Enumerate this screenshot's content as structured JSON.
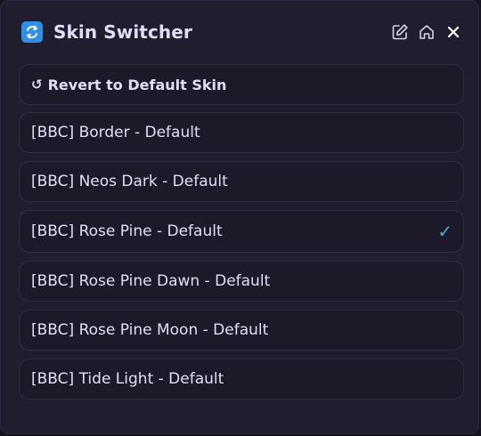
{
  "header": {
    "title": "Skin Switcher",
    "app_icon": "refresh-app-icon",
    "buttons": [
      {
        "icon": "edit-icon"
      },
      {
        "icon": "home-icon"
      },
      {
        "icon": "close-icon"
      }
    ]
  },
  "revert": {
    "glyph": "↺",
    "label": "Revert to Default Skin"
  },
  "skins": [
    {
      "label": "[BBC] Border - Default",
      "selected": false
    },
    {
      "label": "[BBC] Neos Dark - Default",
      "selected": false
    },
    {
      "label": "[BBC] Rose Pine - Default",
      "selected": true
    },
    {
      "label": "[BBC] Rose Pine Dawn - Default",
      "selected": false
    },
    {
      "label": "[BBC] Rose Pine Moon - Default",
      "selected": false
    },
    {
      "label": "[BBC] Tide Light - Default",
      "selected": false
    }
  ],
  "check_glyph": "✓",
  "colors": {
    "panel_bg": "#1f1d2e",
    "text": "#e0def4",
    "accent_check": "#4fa6d9",
    "app_icon_bg": "#2f8fe6"
  }
}
